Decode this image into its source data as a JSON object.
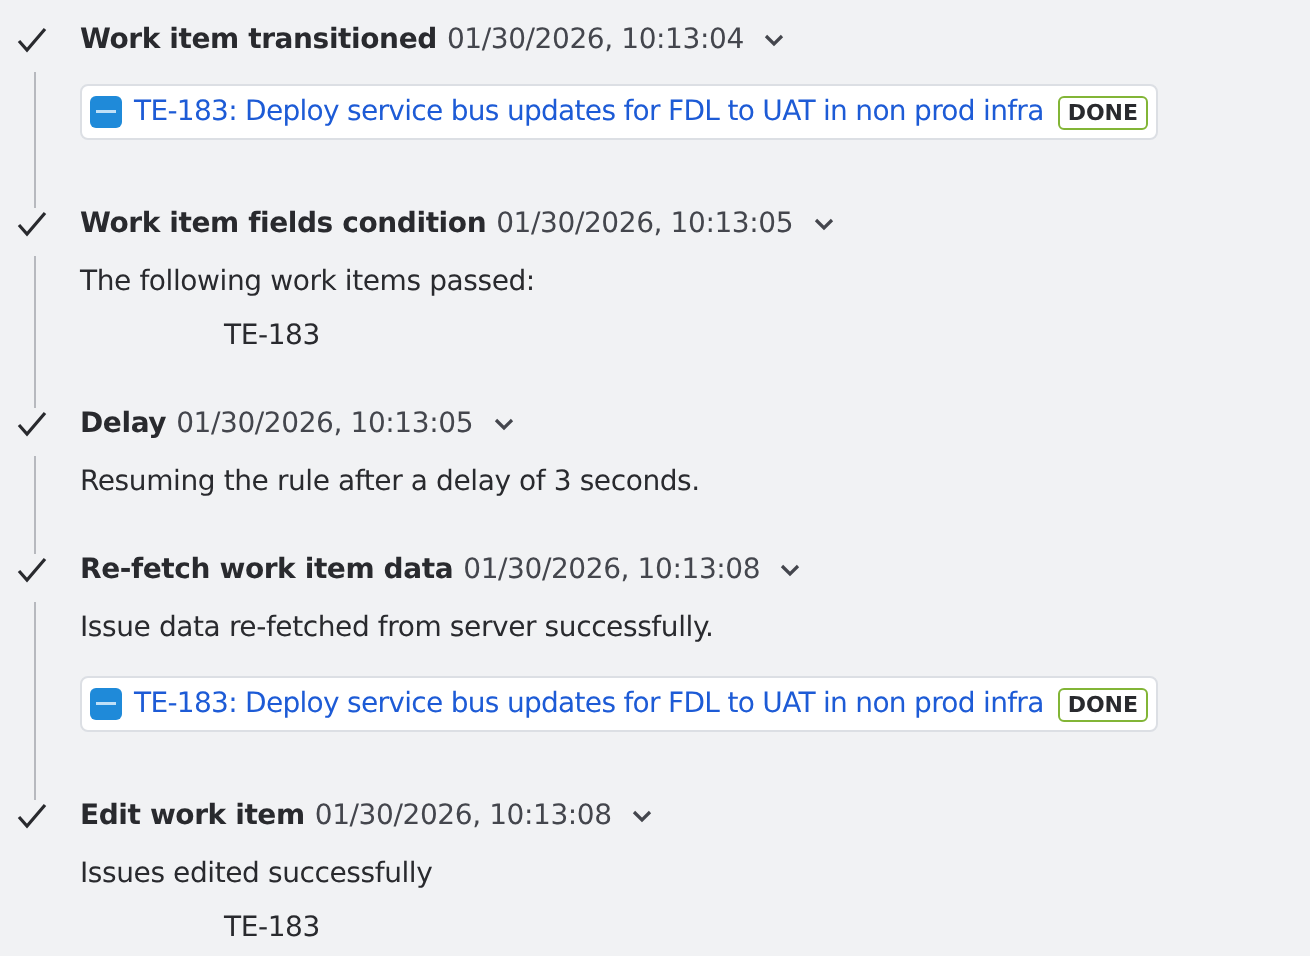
{
  "steps": [
    {
      "title": "Work item transitioned",
      "time": "01/30/2026, 10:13:04",
      "completed": true,
      "content": [
        {
          "kind": "work_item",
          "key_summary": "TE-183: Deploy service bus updates for FDL to UAT in non prod infra",
          "status": "DONE"
        }
      ]
    },
    {
      "title": "Work item fields condition",
      "time": "01/30/2026, 10:13:05",
      "completed": true,
      "content": [
        {
          "kind": "text",
          "text": "The following work items passed:"
        },
        {
          "kind": "key",
          "text": "TE-183"
        }
      ]
    },
    {
      "title": "Delay",
      "time": "01/30/2026, 10:13:05",
      "completed": true,
      "content": [
        {
          "kind": "text",
          "text": "Resuming the rule after a delay of 3 seconds."
        }
      ]
    },
    {
      "title": "Re-fetch work item data",
      "time": "01/30/2026, 10:13:08",
      "completed": true,
      "content": [
        {
          "kind": "text",
          "text": "Issue data re-fetched from server successfully."
        },
        {
          "kind": "work_item",
          "key_summary": "TE-183: Deploy service bus updates for FDL to UAT in non prod infra",
          "status": "DONE"
        }
      ]
    },
    {
      "title": "Edit work item",
      "time": "01/30/2026, 10:13:08",
      "completed": true,
      "content": [
        {
          "kind": "text",
          "text": "Issues edited successfully"
        },
        {
          "kind": "key",
          "text": "TE-183"
        }
      ]
    }
  ]
}
